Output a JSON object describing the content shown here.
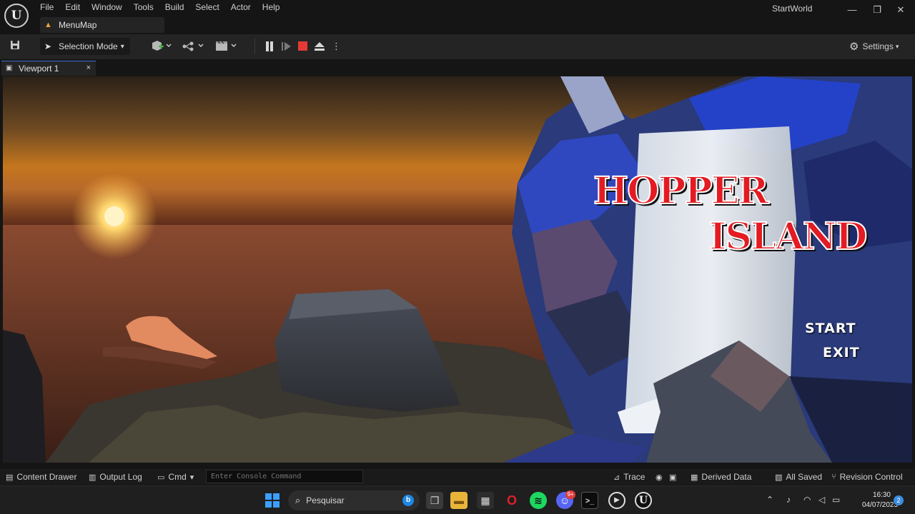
{
  "app": {
    "logo_text": "U",
    "menu": [
      "File",
      "Edit",
      "Window",
      "Tools",
      "Build",
      "Select",
      "Actor",
      "Help"
    ],
    "map_tab": "MenuMap",
    "project_name": "StartWorld",
    "window_controls": {
      "minimize": "—",
      "restore": "❐",
      "close": "✕"
    }
  },
  "toolbar": {
    "mode_label": "Selection Mode",
    "settings_label": "Settings"
  },
  "viewport": {
    "tab_label": "Viewport 1",
    "close_glyph": "×",
    "game": {
      "title_line1": "HOPPER",
      "title_line2": "ISLAND",
      "start": "START",
      "exit": "EXIT"
    }
  },
  "statusbar": {
    "content_drawer": "Content Drawer",
    "output_log": "Output Log",
    "cmd": "Cmd",
    "console_placeholder": "Enter Console Command",
    "trace": "Trace",
    "derived_data": "Derived Data",
    "all_saved": "All Saved",
    "revision_control": "Revision Control"
  },
  "taskbar": {
    "search_placeholder": "Pesquisar",
    "time": "16:30",
    "date": "04/07/2023",
    "notification_count": "2",
    "discord_badge": "9+"
  },
  "colors": {
    "accent_blue": "#3b6fd4",
    "stop_red": "#e53935",
    "title_red": "#e31b23"
  }
}
